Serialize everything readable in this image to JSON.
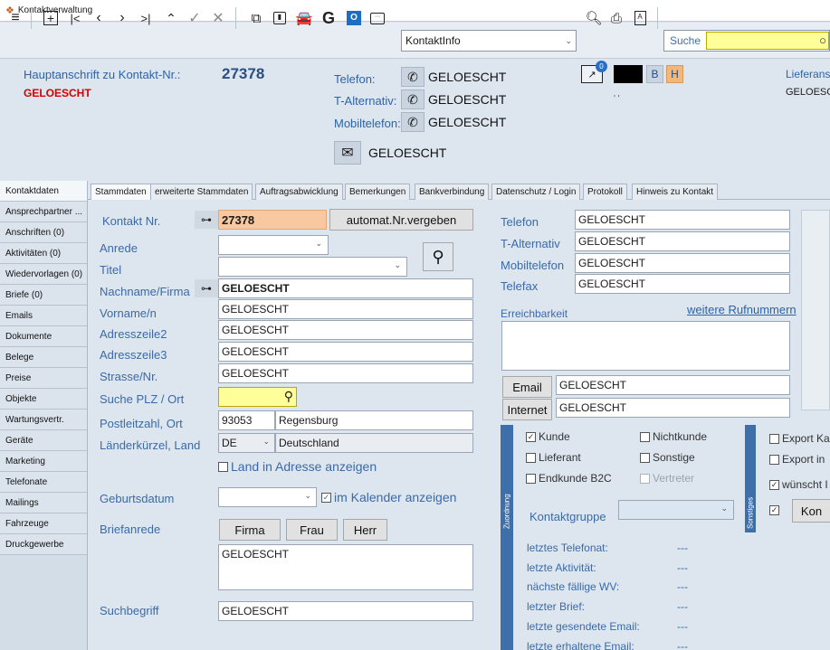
{
  "window_title": "Kontaktverwaltung",
  "toolbar": {
    "combo_value": "KontaktInfo",
    "search_label": "Suche"
  },
  "header": {
    "address_label": "Hauptanschrift zu Kontakt-Nr.:",
    "contact_number": "27378",
    "name": "GELOESCHT",
    "phone_label": "Telefon:",
    "phone_value": "GELOESCHT",
    "alt_label": "T-Alternativ:",
    "alt_value": "GELOESCHT",
    "mobile_label": "Mobiltelefon:",
    "mobile_value": "GELOESCHT",
    "email_value": "GELOESCHT",
    "badge_count": "0",
    "btn_b": "B",
    "btn_h": "H",
    "small_marks": "' '",
    "delivery_label": "Lieferans",
    "delivery_value": "GELOESC"
  },
  "sidebar": {
    "items": [
      "Kontaktdaten",
      "Ansprechpartner ...",
      "Anschriften (0)",
      "Aktivitäten (0)",
      "Wiedervorlagen (0)",
      "Briefe (0)",
      "Emails",
      "Dokumente",
      "Belege",
      "Preise",
      "Objekte",
      "Wartungsvertr.",
      "Geräte",
      "Marketing",
      "Telefonate",
      "Mailings",
      "Fahrzeuge",
      "Druckgewerbe"
    ]
  },
  "tabs": [
    "Stammdaten",
    "erweiterte Stammdaten",
    "Auftragsabwicklung",
    "Bemerkungen",
    "Bankverbindung",
    "Datenschutz / Login",
    "Protokoll",
    "Hinweis zu Kontakt"
  ],
  "form": {
    "kontakt_nr_label": "Kontakt Nr.",
    "kontakt_nr": "27378",
    "auto_nr_button": "automat.Nr.vergeben",
    "anrede_label": "Anrede",
    "titel_label": "Titel",
    "nachname_label": "Nachname/Firma",
    "nachname": "GELOESCHT",
    "vorname_label": "Vorname/n",
    "vorname": "GELOESCHT",
    "adress2_label": "Adresszeile2",
    "adress2": "GELOESCHT",
    "adress3_label": "Adresszeile3",
    "adress3": "GELOESCHT",
    "strasse_label": "Strasse/Nr.",
    "strasse": "GELOESCHT",
    "plz_search_label": "Suche PLZ / Ort",
    "plz_ort_label": "Postleitzahl, Ort",
    "plz": "93053",
    "ort": "Regensburg",
    "land_label": "Länderkürzel, Land",
    "land_code": "DE",
    "land": "Deutschland",
    "land_in_adresse": "Land in Adresse anzeigen",
    "geburtsdatum_label": "Geburtsdatum",
    "kalender_label": "im Kalender anzeigen",
    "briefanrede_label": "Briefanrede",
    "btn_firma": "Firma",
    "btn_frau": "Frau",
    "btn_herr": "Herr",
    "briefanrede": "GELOESCHT",
    "suchbegriff_label": "Suchbegriff",
    "suchbegriff": "GELOESCHT"
  },
  "right": {
    "telefon_label": "Telefon",
    "telefon": "GELOESCHT",
    "alt_label": "T-Alternativ",
    "alt": "GELOESCHT",
    "mobil_label": "Mobiltelefon",
    "mobil": "GELOESCHT",
    "fax_label": "Telefax",
    "fax": "GELOESCHT",
    "erreichbarkeit_label": "Erreichbarkeit",
    "weitere_link": "weitere Rufnummern",
    "email_button": "Email",
    "email": "GELOESCHT",
    "internet_button": "Internet",
    "internet": "GELOESCHT",
    "vbar1": "Zuordnung",
    "vbar2": "Sonstiges",
    "kunde": "Kunde",
    "nichtkunde": "Nichtkunde",
    "lieferant": "Lieferant",
    "sonstige": "Sonstige",
    "endkunde": "Endkunde B2C",
    "vertreter": "Vertreter",
    "kontaktgruppe_label": "Kontaktgruppe",
    "export1": "Export Ka",
    "export2": "Export in",
    "wuenscht": "wünscht I",
    "kon_button": "Kon",
    "info_rows": [
      {
        "label": "letztes Telefonat:",
        "value": "---"
      },
      {
        "label": "letzte Aktivität:",
        "value": "---"
      },
      {
        "label": "nächste fällige WV:",
        "value": "---"
      },
      {
        "label": "letzter Brief:",
        "value": "---"
      },
      {
        "label": "letzte gesendete Email:",
        "value": "---"
      },
      {
        "label": "letzte erhaltene Email:",
        "value": "---"
      }
    ]
  }
}
